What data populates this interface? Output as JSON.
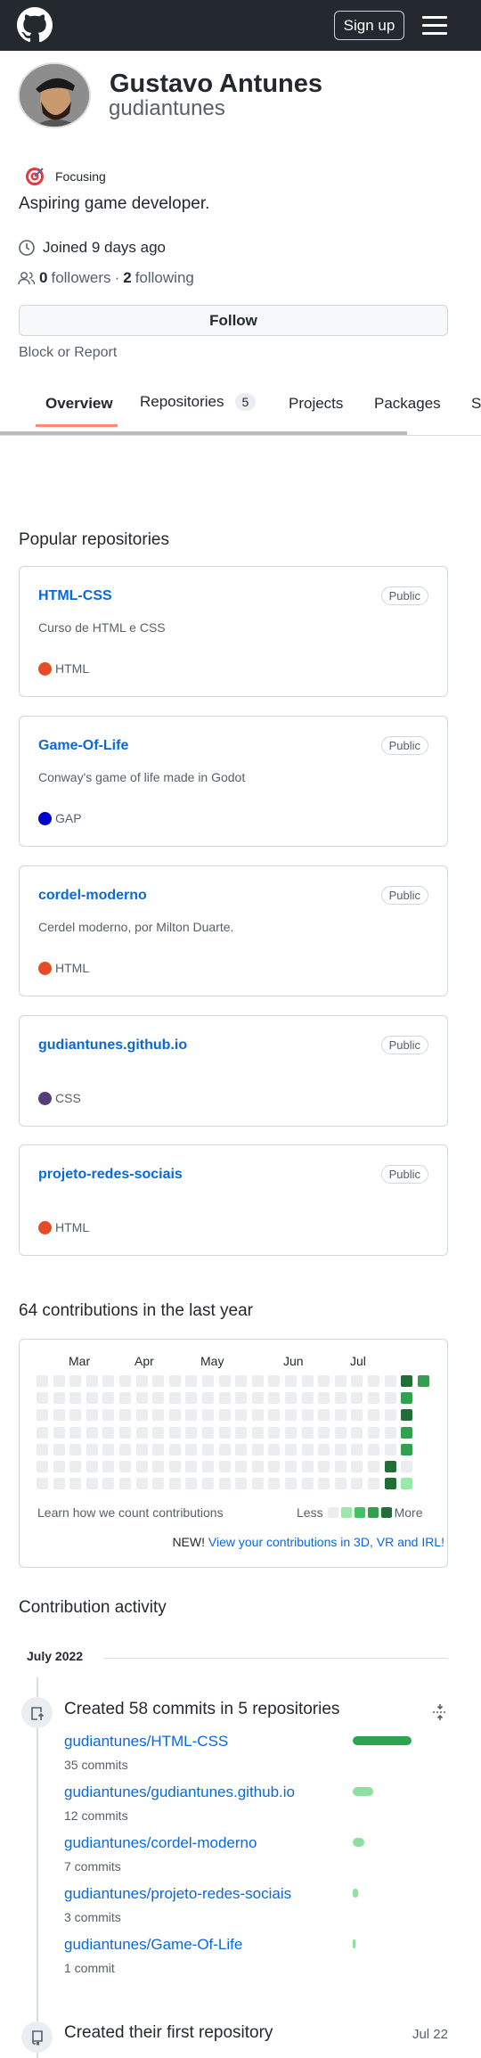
{
  "header": {
    "signup": "Sign up"
  },
  "profile": {
    "name": "Gustavo Antunes",
    "username": "gudiantunes",
    "status": "Focusing",
    "bio": "Aspiring game developer.",
    "joined": "Joined 9 days ago",
    "followers_count": "0",
    "followers_label": "followers",
    "separator": "·",
    "following_count": "2",
    "following_label": "following",
    "follow": "Follow",
    "block": "Block or Report"
  },
  "tabs": [
    {
      "label": "Overview"
    },
    {
      "label": "Repositories",
      "count": "5"
    },
    {
      "label": "Projects"
    },
    {
      "label": "Packages"
    },
    {
      "label": "S"
    }
  ],
  "popular": {
    "title": "Popular repositories",
    "repos": [
      {
        "name": "HTML-CSS",
        "badge": "Public",
        "desc": "Curso de HTML e CSS",
        "lang": "HTML",
        "color": "#e34c26"
      },
      {
        "name": "Game-Of-Life",
        "badge": "Public",
        "desc": "Conway's game of life made in Godot",
        "lang": "GAP",
        "color": "#0000cc"
      },
      {
        "name": "cordel-moderno",
        "badge": "Public",
        "desc": "Cerdel moderno, por Milton Duarte.",
        "lang": "HTML",
        "color": "#e34c26"
      },
      {
        "name": "gudiantunes.github.io",
        "badge": "Public",
        "desc": "",
        "lang": "CSS",
        "color": "#563d7c"
      },
      {
        "name": "projeto-redes-sociais",
        "badge": "Public",
        "desc": "",
        "lang": "HTML",
        "color": "#e34c26"
      }
    ]
  },
  "contributions": {
    "title": "64 contributions in the last year",
    "months": [
      "Mar",
      "Apr",
      "May",
      "Jun",
      "Jul"
    ],
    "levels": [
      "0000000",
      "0000000",
      "0000000",
      "0000000",
      "0000000",
      "0000000",
      "0000000",
      "0000000",
      "0000000",
      "0000000",
      "0000000",
      "0000000",
      "0000000",
      "0000000",
      "0000000",
      "0000000",
      "0000000",
      "0000000",
      "0000000",
      "0000000",
      "0000000",
      "0000044",
      "4343301",
      "3"
    ],
    "level_colors": [
      "#ebedf0",
      "#9be9a8",
      "#40c463",
      "#30a14e",
      "#216e39"
    ],
    "learn": "Learn how we count contributions",
    "less": "Less",
    "more": "More",
    "new": "NEW!",
    "new_link": "View your contributions in 3D, VR and IRL!"
  },
  "activity": {
    "title": "Contribution activity",
    "month": "July 2022",
    "commits_title": "Created 58 commits in 5 repositories",
    "repos": [
      {
        "name": "gudiantunes/HTML-CSS",
        "commits": "35 commits",
        "n": 35,
        "color": "#2da44e"
      },
      {
        "name": "gudiantunes/gudiantunes.github.io",
        "commits": "12 commits",
        "n": 12,
        "color": "#8ee09f"
      },
      {
        "name": "gudiantunes/cordel-moderno",
        "commits": "7 commits",
        "n": 7,
        "color": "#8ee09f"
      },
      {
        "name": "gudiantunes/projeto-redes-sociais",
        "commits": "3 commits",
        "n": 3,
        "color": "#8ee09f"
      },
      {
        "name": "gudiantunes/Game-Of-Life",
        "commits": "1 commit",
        "n": 1,
        "color": "#8ee09f"
      }
    ],
    "first_repo": "Created their first repository",
    "first_repo_date": "Jul 22"
  }
}
